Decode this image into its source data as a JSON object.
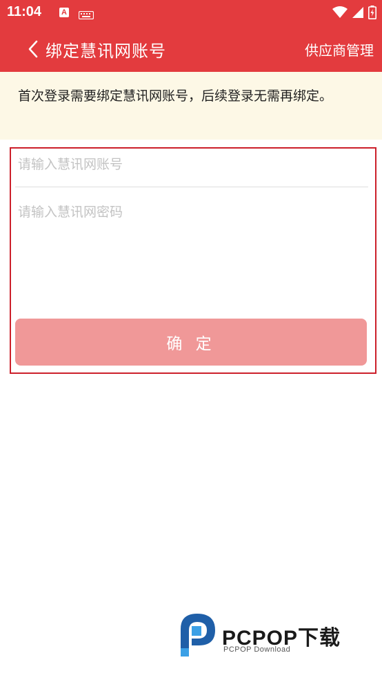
{
  "status_bar": {
    "time": "11:04",
    "app_badge": "A"
  },
  "app_bar": {
    "title": "绑定慧讯网账号",
    "right_link": "供应商管理"
  },
  "notice": {
    "text": "首次登录需要绑定慧讯网账号，后续登录无需再绑定。"
  },
  "form": {
    "account_placeholder": "请输入慧讯网账号",
    "account_value": "",
    "password_placeholder": "请输入慧讯网密码",
    "password_value": "",
    "confirm_label": "确 定"
  },
  "watermark": {
    "brand": "PCPOP下载",
    "sub": "PCPOP Download"
  },
  "colors": {
    "primary": "#e33b3e",
    "notice_bg": "#fdf8e6",
    "button_disabled": "#f09898",
    "highlight_border": "#cc1f2a"
  }
}
